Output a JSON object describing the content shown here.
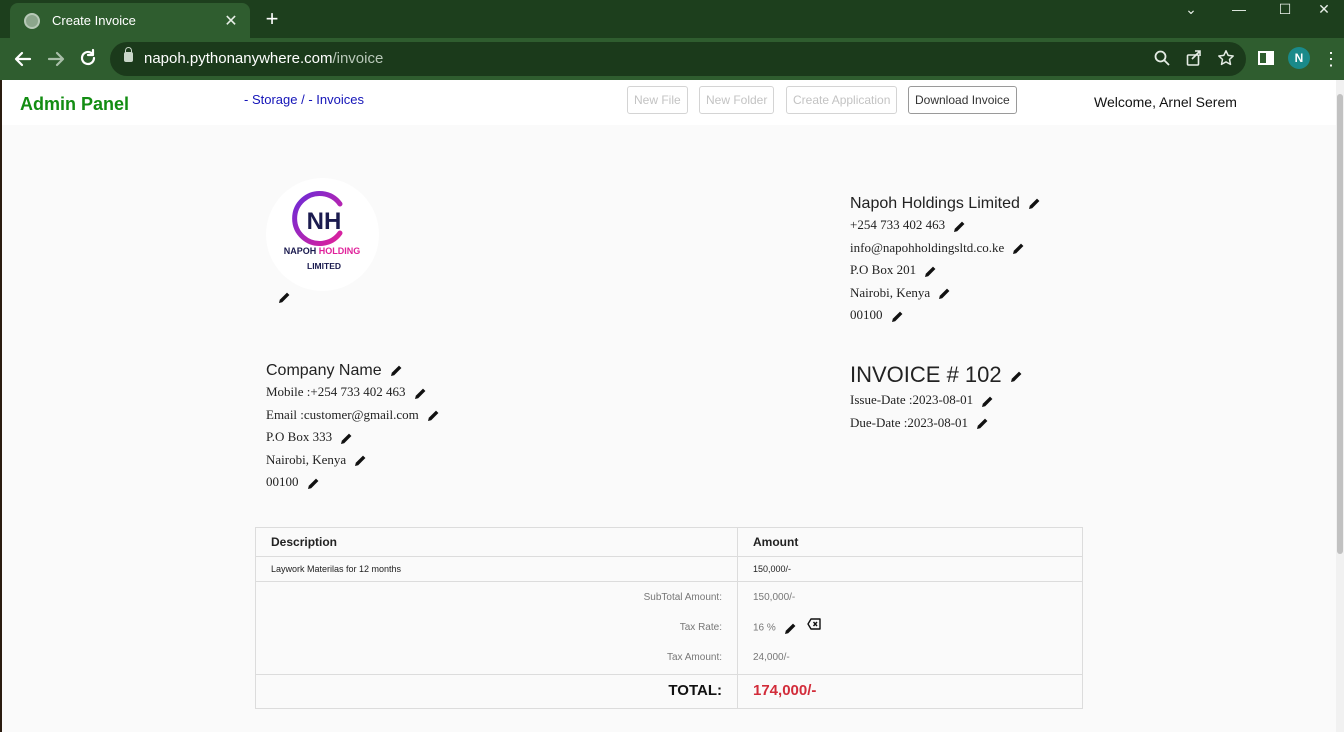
{
  "browser": {
    "tab_title": "Create Invoice",
    "tab_close": "✕",
    "new_tab": "+",
    "url_host": "napoh.pythonanywhere.com",
    "url_path": "/invoice",
    "profile_initial": "N",
    "window_controls": {
      "minimize": "⌄",
      "restore": "—",
      "maximize": "☐",
      "close": "✕"
    }
  },
  "header": {
    "brand": "Admin Panel",
    "breadcrumb": {
      "storage": "- Storage /",
      "invoices": "- Invoices"
    },
    "buttons": {
      "new_file": "New File",
      "new_folder": "New Folder",
      "create_application": "Create Application",
      "download_invoice": "Download Invoice"
    },
    "welcome": "Welcome, Arnel Serem"
  },
  "logo": {
    "letters": "NH",
    "line1_a": "NAPOH",
    "line1_b": "HOLDING",
    "line2": "LIMITED",
    "colors": {
      "navy": "#1b1b4f",
      "magenta": "#e0219a",
      "purple": "#6a2bd8"
    }
  },
  "company": {
    "name": "Napoh Holdings Limited",
    "phone": "+254 733 402 463",
    "email": "info@napohholdingsltd.co.ke",
    "po_box": "P.O Box 201",
    "city": "Nairobi, Kenya",
    "postal": "00100"
  },
  "client": {
    "name": "Company Name",
    "mobile": "Mobile :+254 733 402 463",
    "email": "Email :customer@gmail.com",
    "po_box": "P.O Box 333",
    "city": "Nairobi, Kenya",
    "postal": "00100"
  },
  "invoice": {
    "title": "INVOICE # 102",
    "issue_date": "Issue-Date :2023-08-01",
    "due_date": "Due-Date :2023-08-01"
  },
  "table": {
    "headers": {
      "description": "Description",
      "amount": "Amount"
    },
    "items": [
      {
        "description": "Laywork Materilas for 12 months",
        "amount": "150,000/-"
      }
    ],
    "subtotal_label": "SubTotal Amount:",
    "subtotal_value": "150,000/-",
    "tax_rate_label": "Tax Rate:",
    "tax_rate_value": "16 %",
    "tax_amount_label": "Tax Amount:",
    "tax_amount_value": "24,000/-",
    "total_label": "TOTAL:",
    "total_value": "174,000/-",
    "total_color": "#d22c3a"
  },
  "theme": {
    "brand_green": "#138d13",
    "link_blue": "#1414b8",
    "chrome_green": "#2f5d2f"
  }
}
